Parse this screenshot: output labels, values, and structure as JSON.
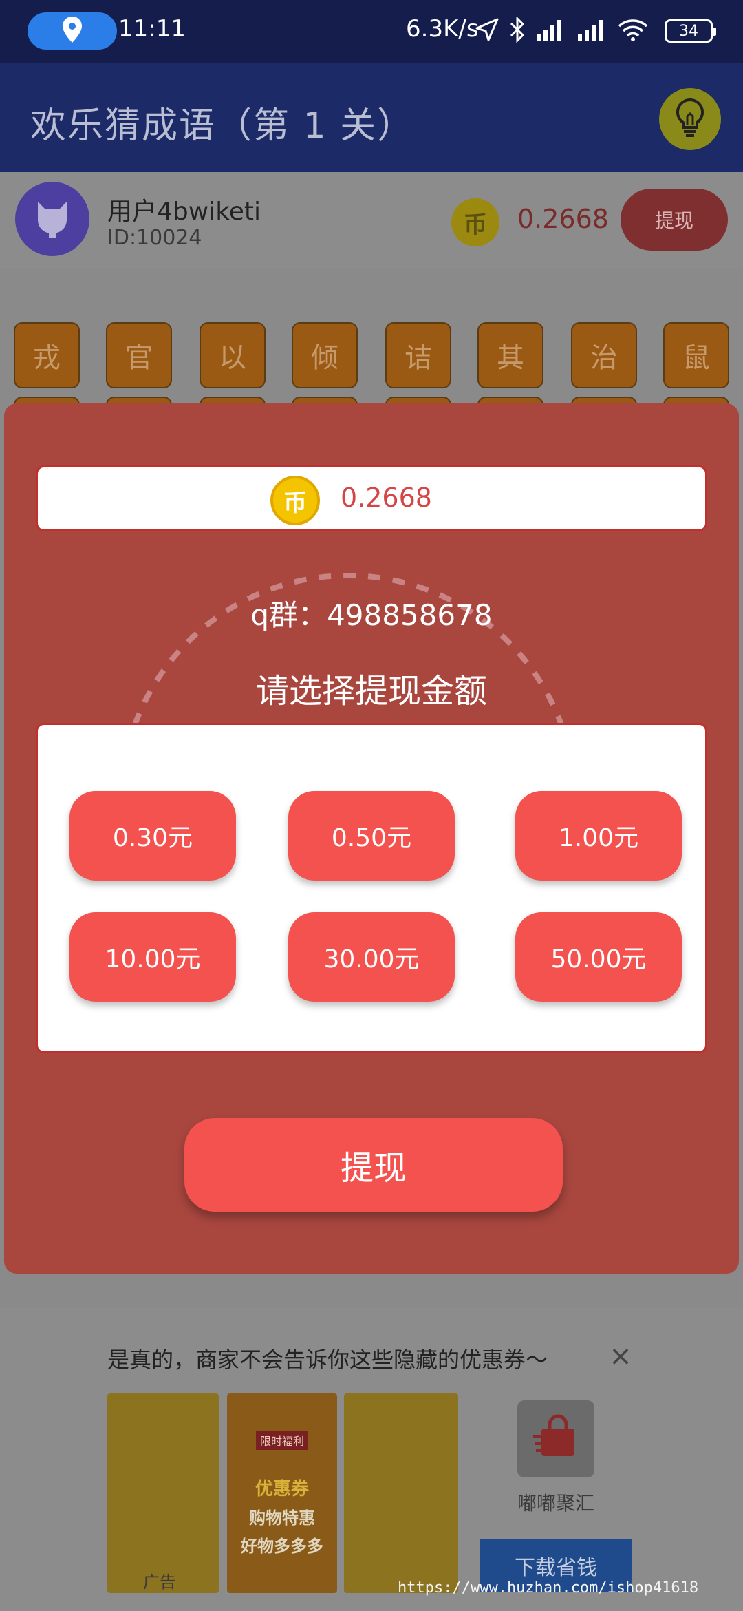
{
  "status_bar": {
    "time": "11:11",
    "net_speed": "6.3K/s",
    "battery": "34",
    "icons": [
      "location-icon",
      "navigation-icon",
      "bluetooth-icon",
      "signal-icon",
      "signal-icon",
      "wifi-icon",
      "battery-icon"
    ]
  },
  "app_bar": {
    "title": "欢乐猜成语（第 1 关）",
    "hint_icon": "lightbulb-icon"
  },
  "user": {
    "name": "用户4bwiketi",
    "id": "ID:10024",
    "coin_symbol": "币",
    "balance": "0.2668",
    "withdraw_label": "提现"
  },
  "idiom_chars": [
    "戎",
    "官",
    "以",
    "倾",
    "诘",
    "其",
    "治",
    "鼠"
  ],
  "modal": {
    "coin_symbol": "币",
    "balance": "0.2668",
    "qq_group": "q群：498858678",
    "choose_label": "请选择提现金额",
    "amounts": [
      "0.30元",
      "0.50元",
      "1.00元",
      "10.00元",
      "30.00元",
      "50.00元"
    ],
    "withdraw_label": "提现"
  },
  "ad": {
    "text": "是真的，商家不会告诉你这些隐藏的优惠券～",
    "label": "广告",
    "img_text": [
      "优惠券",
      "购物特惠",
      "好物多多多"
    ],
    "badge": "限时福利",
    "brand": "嘟嘟聚汇",
    "download_label": "下载省钱"
  },
  "watermark": "https://www.huzhan.com/ishop41618",
  "colors": {
    "status_bg": "#141d4c",
    "appbar_bg": "#1c2a68",
    "modal_bg": "#a9473f",
    "button_red": "#f4524f",
    "coin_gold": "#f5c400"
  }
}
